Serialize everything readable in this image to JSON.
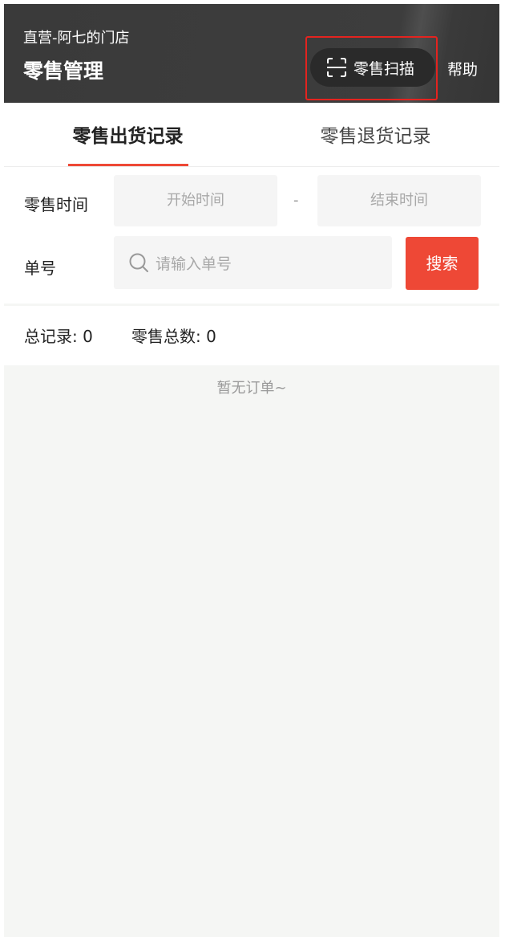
{
  "header": {
    "store_name": "直营-阿七的门店",
    "title": "零售管理",
    "scan_button": {
      "label": "零售扫描",
      "icon": "scan-icon"
    },
    "help_label": "帮助"
  },
  "tabs": [
    {
      "label": "零售出货记录",
      "active": true
    },
    {
      "label": "零售退货记录",
      "active": false
    }
  ],
  "filters": {
    "time_label": "零售时间",
    "start_placeholder": "开始时间",
    "separator": "-",
    "end_placeholder": "结束时间",
    "order_label": "单号",
    "order_placeholder": "请输入单号",
    "search_label": "搜索",
    "search_icon": "search-icon"
  },
  "summary": {
    "total_records": "总记录: 0",
    "total_sales": "零售总数: 0"
  },
  "empty_state": "暂无订单~",
  "colors": {
    "header_bg": "#3a3a3a",
    "accent": "#ee4836",
    "highlight_box": "#e4231f",
    "page_bg": "#f5f6f4"
  }
}
